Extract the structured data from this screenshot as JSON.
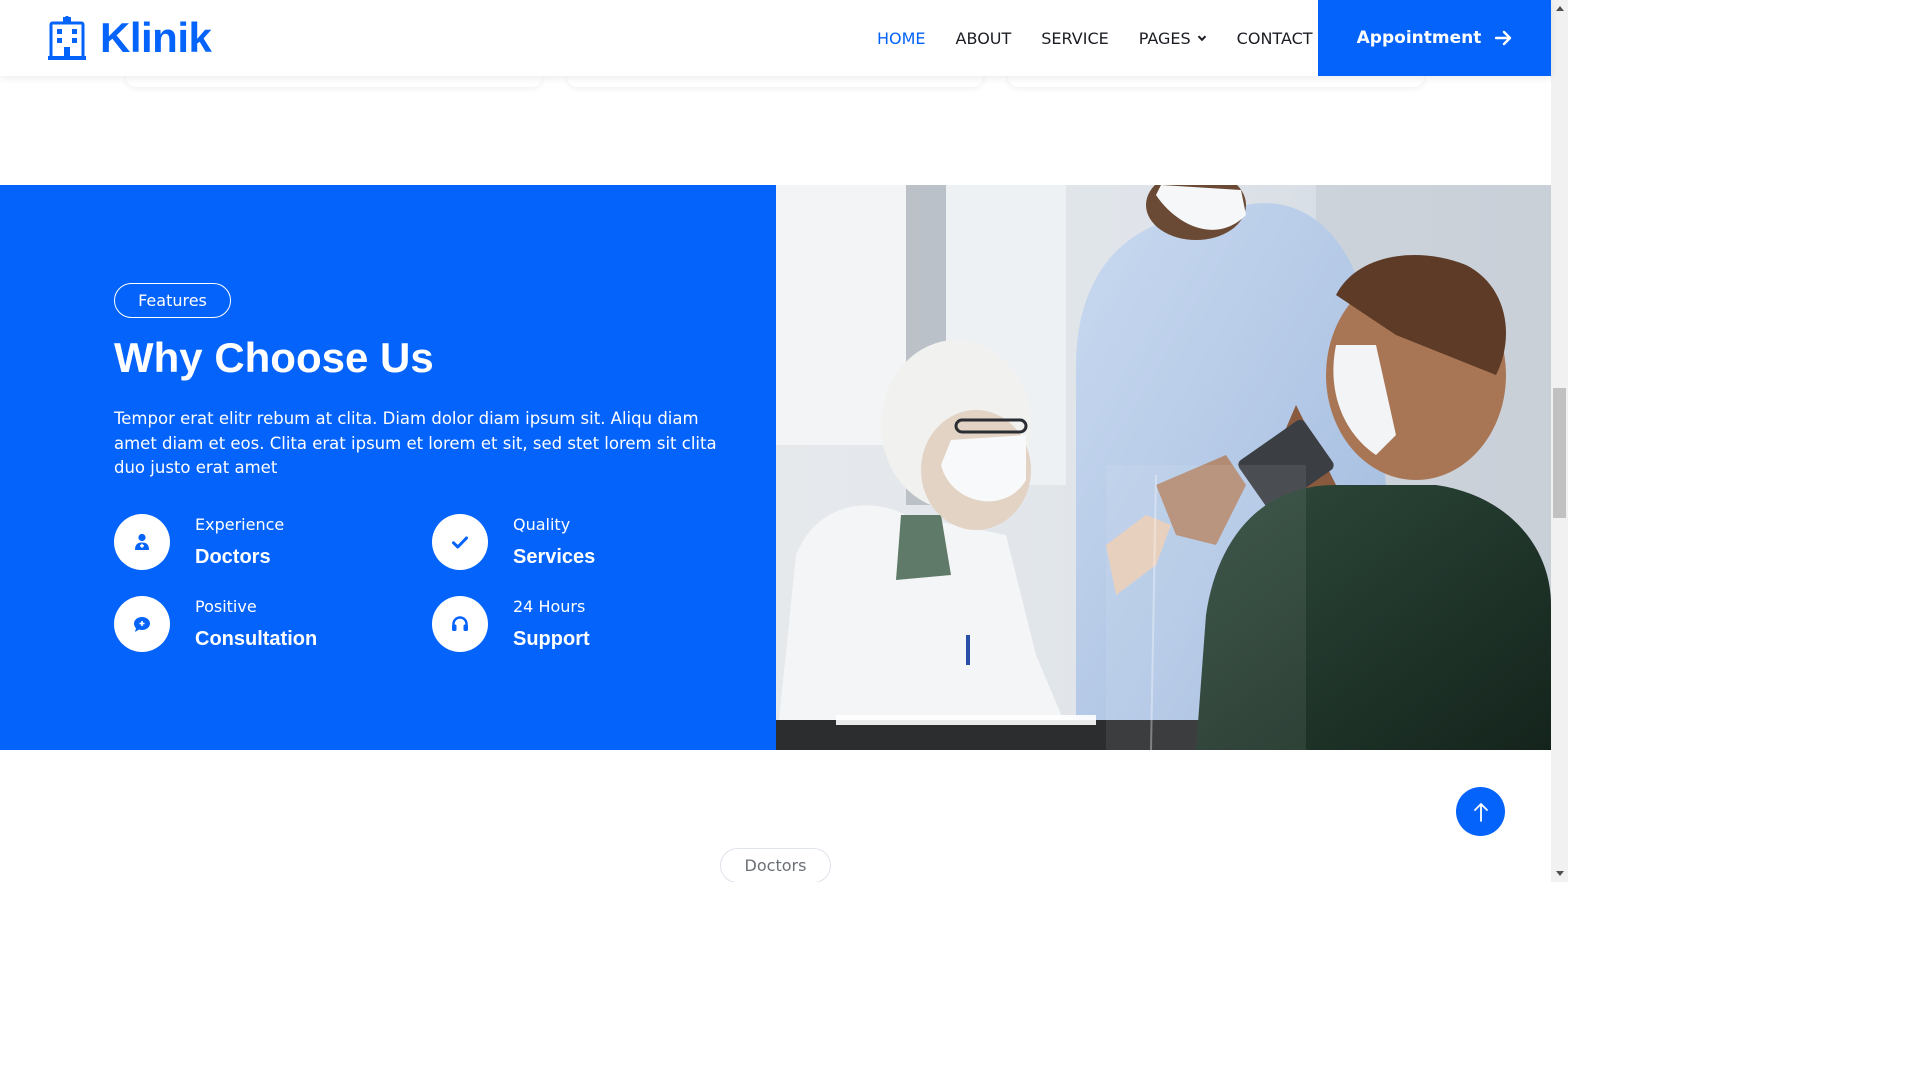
{
  "brand": {
    "name": "Klinik",
    "icon": "hospital-icon",
    "color": "#0463fa"
  },
  "nav": {
    "items": [
      {
        "label": "HOME",
        "active": true
      },
      {
        "label": "ABOUT",
        "active": false
      },
      {
        "label": "SERVICE",
        "active": false
      },
      {
        "label": "PAGES",
        "active": false,
        "dropdown": true
      },
      {
        "label": "CONTACT",
        "active": false
      }
    ],
    "cta_label": "Appointment",
    "cta_icon": "arrow-right-icon"
  },
  "features": {
    "badge": "Features",
    "title": "Why Choose Us",
    "description": "Tempor erat elitr rebum at clita. Diam dolor diam ipsum sit. Aliqu diam amet diam et eos. Clita erat ipsum et lorem et sit, sed stet lorem sit clita duo justo erat amet",
    "items": [
      {
        "small": "Experience",
        "big": "Doctors",
        "icon": "doctor-icon"
      },
      {
        "small": "Quality",
        "big": "Services",
        "icon": "check-icon"
      },
      {
        "small": "Positive",
        "big": "Consultation",
        "icon": "comment-medical-icon"
      },
      {
        "small": "24 Hours",
        "big": "Support",
        "icon": "headphones-icon"
      }
    ],
    "image": "doctors-consultation-photo"
  },
  "doctors_section": {
    "badge": "Doctors"
  },
  "back_to_top_icon": "arrow-up-icon",
  "accent_color": "#0463fa"
}
